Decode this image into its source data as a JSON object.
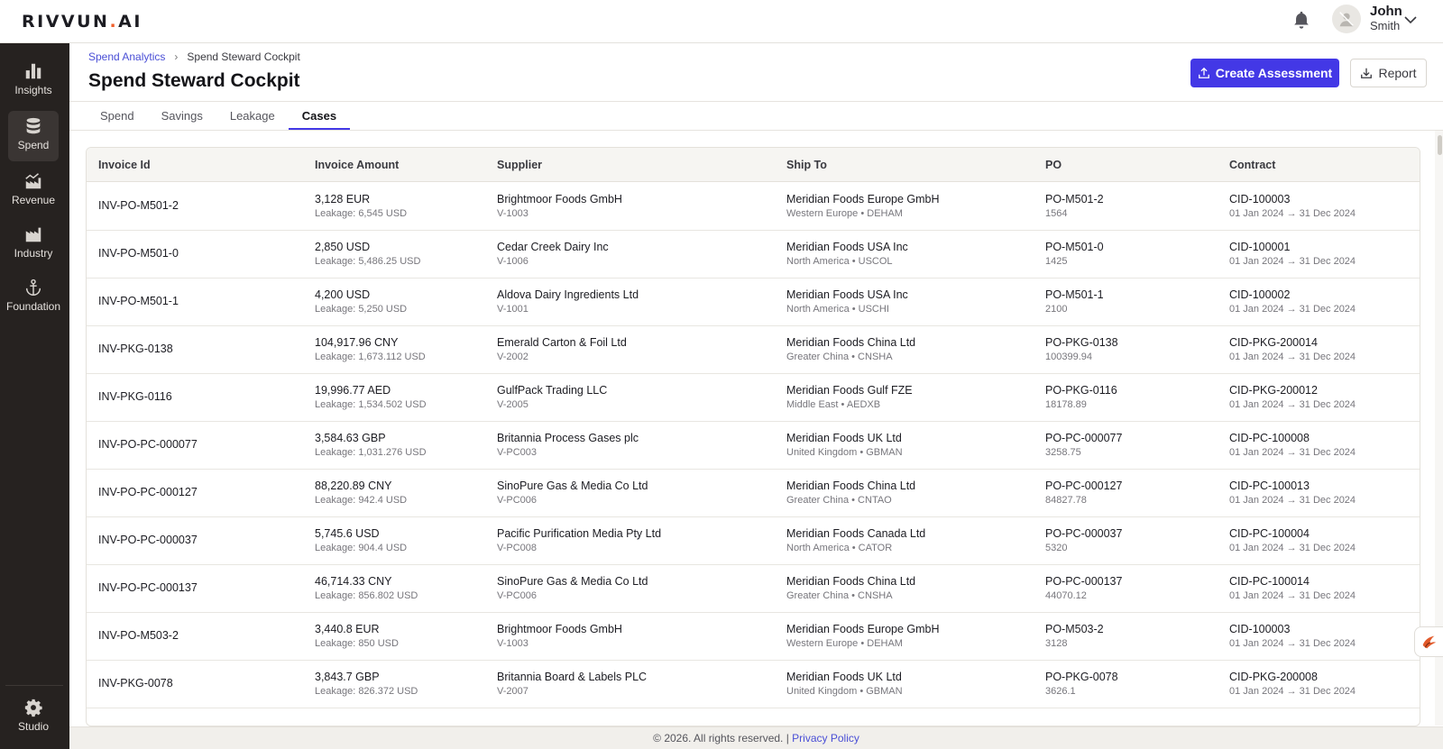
{
  "brand": {
    "logo_main": "RIVVUN",
    "logo_dot": ".",
    "logo_ai": "AI",
    "accent": "#f0602c"
  },
  "user": {
    "first_name": "John",
    "last_name": "Smith"
  },
  "sidebar": {
    "items": [
      {
        "label": "Insights",
        "icon": "bar-chart-icon",
        "active": false
      },
      {
        "label": "Spend",
        "icon": "database-icon",
        "active": true
      },
      {
        "label": "Revenue",
        "icon": "factory-chart-icon",
        "active": false
      },
      {
        "label": "Industry",
        "icon": "factory-icon",
        "active": false
      },
      {
        "label": "Foundation",
        "icon": "anchor-icon",
        "active": false
      }
    ],
    "studio_label": "Studio"
  },
  "breadcrumb": {
    "parent": "Spend Analytics",
    "current": "Spend Steward Cockpit"
  },
  "page": {
    "title": "Spend Steward Cockpit"
  },
  "actions": {
    "create_label": "Create Assessment",
    "report_label": "Report",
    "primary_color": "#4338e6"
  },
  "tabs": [
    {
      "label": "Spend",
      "active": false
    },
    {
      "label": "Savings",
      "active": false
    },
    {
      "label": "Leakage",
      "active": false
    },
    {
      "label": "Cases",
      "active": true
    }
  ],
  "table": {
    "columns": [
      "Invoice Id",
      "Invoice Amount",
      "Supplier",
      "Ship To",
      "PO",
      "Contract"
    ],
    "rows": [
      {
        "invoice_id": "INV-PO-M501-2",
        "amount": "3,128 EUR",
        "leakage": "Leakage: 6,545 USD",
        "supplier": "Brightmoor Foods GmbH",
        "supplier_id": "V-1003",
        "ship_to": "Meridian Foods Europe GmbH",
        "ship_region": "Western Europe • DEHAM",
        "po": "PO-M501-2",
        "po_value": "1564",
        "contract": "CID-100003",
        "contract_period": "01 Jan 2024 → 31 Dec 2024"
      },
      {
        "invoice_id": "INV-PO-M501-0",
        "amount": "2,850 USD",
        "leakage": "Leakage: 5,486.25 USD",
        "supplier": "Cedar Creek Dairy Inc",
        "supplier_id": "V-1006",
        "ship_to": "Meridian Foods USA Inc",
        "ship_region": "North America • USCOL",
        "po": "PO-M501-0",
        "po_value": "1425",
        "contract": "CID-100001",
        "contract_period": "01 Jan 2024 → 31 Dec 2024"
      },
      {
        "invoice_id": "INV-PO-M501-1",
        "amount": "4,200 USD",
        "leakage": "Leakage: 5,250 USD",
        "supplier": "Aldova Dairy Ingredients Ltd",
        "supplier_id": "V-1001",
        "ship_to": "Meridian Foods USA Inc",
        "ship_region": "North America • USCHI",
        "po": "PO-M501-1",
        "po_value": "2100",
        "contract": "CID-100002",
        "contract_period": "01 Jan 2024 → 31 Dec 2024"
      },
      {
        "invoice_id": "INV-PKG-0138",
        "amount": "104,917.96 CNY",
        "leakage": "Leakage: 1,673.112 USD",
        "supplier": "Emerald Carton & Foil Ltd",
        "supplier_id": "V-2002",
        "ship_to": "Meridian Foods China Ltd",
        "ship_region": "Greater China • CNSHA",
        "po": "PO-PKG-0138",
        "po_value": "100399.94",
        "contract": "CID-PKG-200014",
        "contract_period": "01 Jan 2024 → 31 Dec 2024"
      },
      {
        "invoice_id": "INV-PKG-0116",
        "amount": "19,996.77 AED",
        "leakage": "Leakage: 1,534.502 USD",
        "supplier": "GulfPack Trading LLC",
        "supplier_id": "V-2005",
        "ship_to": "Meridian Foods Gulf FZE",
        "ship_region": "Middle East • AEDXB",
        "po": "PO-PKG-0116",
        "po_value": "18178.89",
        "contract": "CID-PKG-200012",
        "contract_period": "01 Jan 2024 → 31 Dec 2024"
      },
      {
        "invoice_id": "INV-PO-PC-000077",
        "amount": "3,584.63 GBP",
        "leakage": "Leakage: 1,031.276 USD",
        "supplier": "Britannia Process Gases plc",
        "supplier_id": "V-PC003",
        "ship_to": "Meridian Foods UK Ltd",
        "ship_region": "United Kingdom • GBMAN",
        "po": "PO-PC-000077",
        "po_value": "3258.75",
        "contract": "CID-PC-100008",
        "contract_period": "01 Jan 2024 → 31 Dec 2024"
      },
      {
        "invoice_id": "INV-PO-PC-000127",
        "amount": "88,220.89 CNY",
        "leakage": "Leakage: 942.4 USD",
        "supplier": "SinoPure Gas & Media Co Ltd",
        "supplier_id": "V-PC006",
        "ship_to": "Meridian Foods China Ltd",
        "ship_region": "Greater China • CNTAO",
        "po": "PO-PC-000127",
        "po_value": "84827.78",
        "contract": "CID-PC-100013",
        "contract_period": "01 Jan 2024 → 31 Dec 2024"
      },
      {
        "invoice_id": "INV-PO-PC-000037",
        "amount": "5,745.6 USD",
        "leakage": "Leakage: 904.4 USD",
        "supplier": "Pacific Purification Media Pty Ltd",
        "supplier_id": "V-PC008",
        "ship_to": "Meridian Foods Canada Ltd",
        "ship_region": "North America • CATOR",
        "po": "PO-PC-000037",
        "po_value": "5320",
        "contract": "CID-PC-100004",
        "contract_period": "01 Jan 2024 → 31 Dec 2024"
      },
      {
        "invoice_id": "INV-PO-PC-000137",
        "amount": "46,714.33 CNY",
        "leakage": "Leakage: 856.802 USD",
        "supplier": "SinoPure Gas & Media Co Ltd",
        "supplier_id": "V-PC006",
        "ship_to": "Meridian Foods China Ltd",
        "ship_region": "Greater China • CNSHA",
        "po": "PO-PC-000137",
        "po_value": "44070.12",
        "contract": "CID-PC-100014",
        "contract_period": "01 Jan 2024 → 31 Dec 2024"
      },
      {
        "invoice_id": "INV-PO-M503-2",
        "amount": "3,440.8 EUR",
        "leakage": "Leakage: 850 USD",
        "supplier": "Brightmoor Foods GmbH",
        "supplier_id": "V-1003",
        "ship_to": "Meridian Foods Europe GmbH",
        "ship_region": "Western Europe • DEHAM",
        "po": "PO-M503-2",
        "po_value": "3128",
        "contract": "CID-100003",
        "contract_period": "01 Jan 2024 → 31 Dec 2024"
      },
      {
        "invoice_id": "INV-PKG-0078",
        "amount": "3,843.7 GBP",
        "leakage": "Leakage: 826.372 USD",
        "supplier": "Britannia Board & Labels PLC",
        "supplier_id": "V-2007",
        "ship_to": "Meridian Foods UK Ltd",
        "ship_region": "United Kingdom • GBMAN",
        "po": "PO-PKG-0078",
        "po_value": "3626.1",
        "contract": "CID-PKG-200008",
        "contract_period": "01 Jan 2024 → 31 Dec 2024"
      }
    ]
  },
  "footer": {
    "text": "© 2026. All rights reserved. | ",
    "link": "Privacy Policy"
  }
}
